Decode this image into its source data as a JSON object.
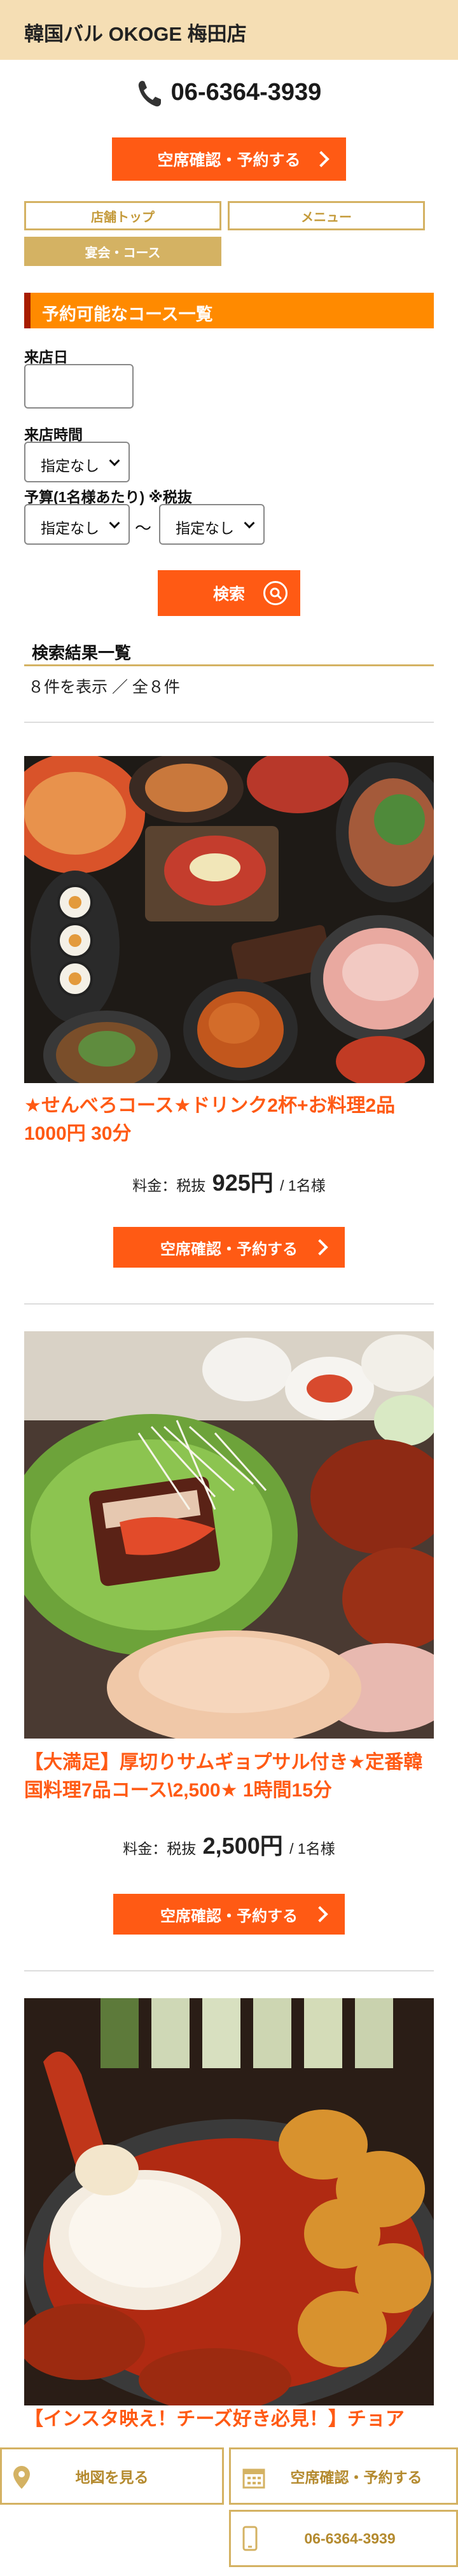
{
  "header": {
    "title": "韓国バル OKOGE 梅田店"
  },
  "phone": {
    "number": "06-6364-3939"
  },
  "reserve_button": {
    "label": "空席確認・予約する"
  },
  "tabs": [
    {
      "label": "店舗トップ"
    },
    {
      "label": "メニュー"
    },
    {
      "label": "宴会・コース"
    }
  ],
  "section": {
    "title": "予約可能なコース一覧"
  },
  "form": {
    "date_label": "来店日",
    "time_label": "来店時間",
    "time_value": "指定なし",
    "budget_label": "予算(1名様あたり) ※税抜",
    "budget_min": "指定なし",
    "budget_sep": "〜",
    "budget_max": "指定なし",
    "search_label": "検索"
  },
  "results": {
    "title": "検索結果一覧",
    "count": "８件を表示 ／ 全８件"
  },
  "courses": [
    {
      "title": "★せんべろコース★ドリンク2杯+お料理2品1000円 30分",
      "price_prefix": "料金：税抜",
      "price": "925円",
      "price_unit": "/ 1名様",
      "button": "空席確認・予約する"
    },
    {
      "title": "【大満足】厚切りサムギョプサル付き★定番韓国料理7品コース\\2,500★ 1時間15分",
      "price_prefix": "料金：税抜",
      "price": "2,500円",
      "price_unit": "/ 1名様",
      "button": "空席確認・予約する"
    },
    {
      "title": "【インスタ映え！チーズ好き必見！】チョア"
    }
  ],
  "footer": {
    "map_label": "地図を見る",
    "reserve_label": "空席確認・予約する",
    "phone_label": "06-6364-3939"
  },
  "colors": {
    "accent": "#ff5a14",
    "gold": "#d4b263",
    "header_bg": "#f5deb4"
  }
}
